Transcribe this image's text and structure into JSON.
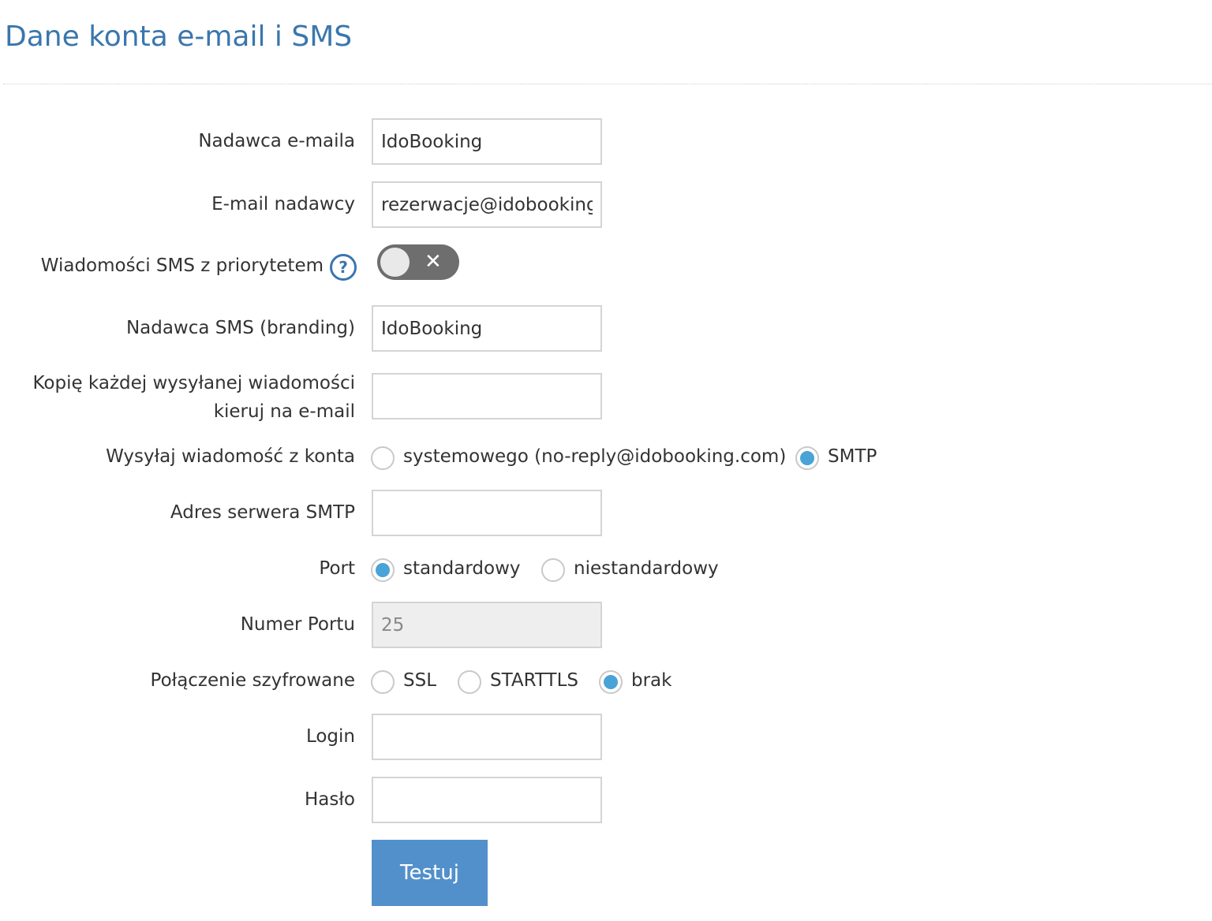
{
  "page": {
    "title": "Dane konta e-mail i SMS"
  },
  "form": {
    "email_sender_name": {
      "label": "Nadawca e-maila",
      "value": "IdoBooking"
    },
    "sender_email": {
      "label": "E-mail nadawcy",
      "value": "rezerwacje@idobooking."
    },
    "priority_sms": {
      "label": "Wiadomości SMS z priorytetem",
      "help_icon": "question-circle-icon",
      "toggle_state": "off",
      "toggle_symbol": "✕"
    },
    "sms_sender": {
      "label": "Nadawca SMS (branding)",
      "value": "IdoBooking"
    },
    "copy_email": {
      "label_line1": "Kopię każdej wysyłanej wiadomości",
      "label_line2": "kieruj na e-mail",
      "value": ""
    },
    "send_from": {
      "label": "Wysyłaj wiadomość z konta",
      "options": [
        {
          "label": "systemowego (no-reply@idobooking.com)",
          "checked": false
        },
        {
          "label": "SMTP",
          "checked": true
        }
      ]
    },
    "smtp_server": {
      "label": "Adres serwera SMTP",
      "value": ""
    },
    "port": {
      "label": "Port",
      "options": [
        {
          "label": "standardowy",
          "checked": true
        },
        {
          "label": "niestandardowy",
          "checked": false
        }
      ]
    },
    "port_number": {
      "label": "Numer Portu",
      "value": "25",
      "disabled": true
    },
    "encryption": {
      "label": "Połączenie szyfrowane",
      "options": [
        {
          "label": "SSL",
          "checked": false
        },
        {
          "label": "STARTTLS",
          "checked": false
        },
        {
          "label": "brak",
          "checked": true
        }
      ]
    },
    "login": {
      "label": "Login",
      "value": ""
    },
    "password": {
      "label": "Hasło",
      "value": ""
    },
    "test_button": {
      "label": "Testuj"
    }
  },
  "colors": {
    "title": "#3a76ad",
    "button": "#5290cb",
    "radio_checked": "#4aa3d6",
    "toggle_off": "#6e6e6e"
  }
}
